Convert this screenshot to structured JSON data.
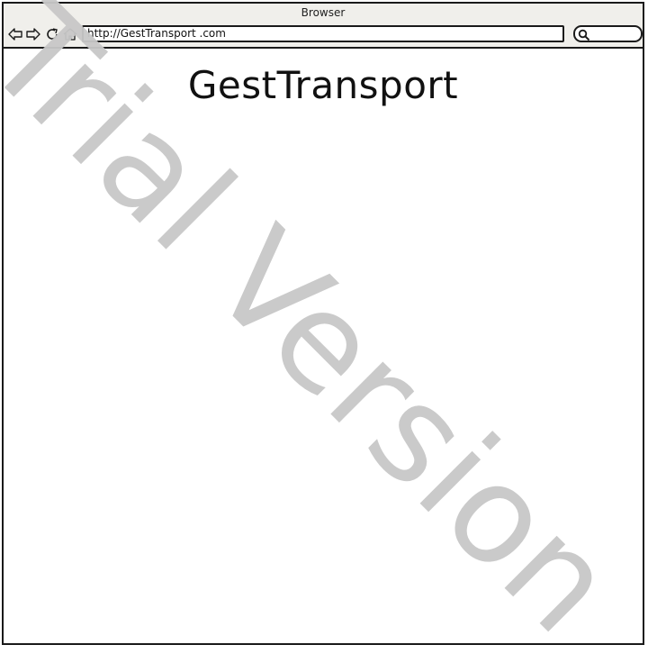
{
  "window": {
    "title": "Browser"
  },
  "toolbar": {
    "url": "http://GestTransport .com",
    "icons": [
      "back-arrow-icon",
      "forward-arrow-icon",
      "reload-icon",
      "home-icon",
      "search-icon"
    ]
  },
  "page": {
    "heading": "GestTransport"
  },
  "watermark": {
    "text": "Trial Version",
    "color": "#c8c8c8"
  }
}
